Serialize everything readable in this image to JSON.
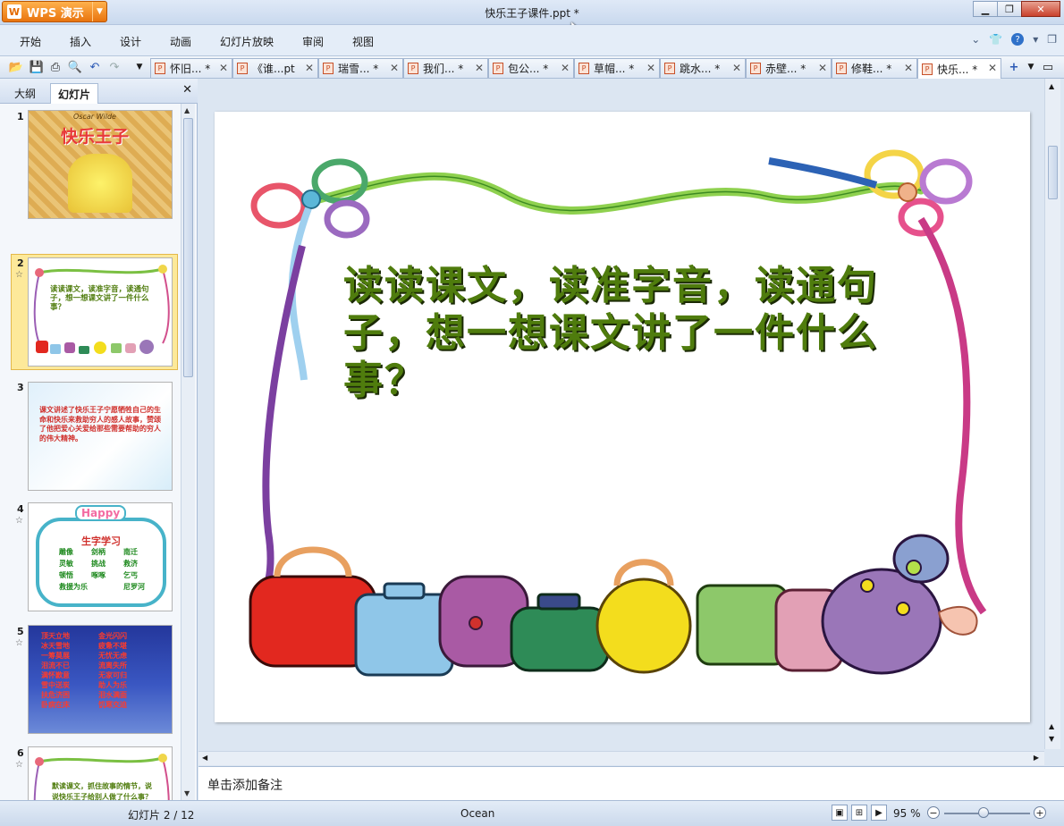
{
  "app": {
    "name": "WPS 演示",
    "logo_glyph": "W"
  },
  "window": {
    "title": "快乐王子课件.ppt *"
  },
  "menu": {
    "items": [
      "开始",
      "插入",
      "设计",
      "动画",
      "幻灯片放映",
      "审阅",
      "视图"
    ]
  },
  "tabs": [
    {
      "label": "怀旧... *"
    },
    {
      "label": "《谁...pt"
    },
    {
      "label": "瑞雪... *"
    },
    {
      "label": "我们... *"
    },
    {
      "label": "包公... *"
    },
    {
      "label": "草帽... *"
    },
    {
      "label": "跳水... *"
    },
    {
      "label": "赤壁... *"
    },
    {
      "label": "修鞋... *"
    },
    {
      "label": "快乐... *"
    }
  ],
  "left_pane": {
    "tab_outline": "大纲",
    "tab_slides": "幻灯片",
    "thumbnails": [
      {
        "num": "1",
        "cover_title": "快乐王子",
        "cover_subtitle": "Oscar Wilde"
      },
      {
        "num": "2",
        "text": "读读课文，读准字音，读通句子，想一想课文讲了一件什么事？"
      },
      {
        "num": "3",
        "text": "课文讲述了快乐王子宁愿牺牲自己的生命和快乐来救助穷人的感人故事，赞颂了他把爱心关爱给那些需要帮助的穷人的伟大精神。"
      },
      {
        "num": "4",
        "banner": "Happy",
        "heading": "生字学习",
        "words": [
          "雕像",
          "剑柄",
          "南迁",
          "灵敏",
          "挑战",
          "救济",
          "顿悟",
          "啄啄",
          "乞丐",
          "救援为乐",
          "尼罗河"
        ]
      },
      {
        "num": "5",
        "words": [
          "顶天立地",
          "金光闪闪",
          "冰天雪地",
          "疲惫不堪",
          "一筹莫展",
          "无忧无虑",
          "泪流不已",
          "流离失所",
          "满怀歉意",
          "无家可归",
          "雪中送炭",
          "助人为乐",
          "扶危济困",
          "泪水满面",
          "卧病在床",
          "饥寒交迫"
        ]
      },
      {
        "num": "6",
        "text": "默读课文，抓住故事的情节，说说快乐王子给别人做了什么事？"
      }
    ]
  },
  "slide": {
    "text": "读读课文，读准字音，读通句子，想一想课文讲了一件什么事？"
  },
  "notes": {
    "placeholder": "单击添加备注"
  },
  "status": {
    "slide_counter": "幻灯片 2 / 12",
    "theme": "Ocean",
    "zoom": "95 %",
    "zoom_level": 95
  },
  "colors": {
    "slide_text": "#4f7c0d",
    "app_button": "#e8740e",
    "selected_thumb": "#fde99a"
  }
}
